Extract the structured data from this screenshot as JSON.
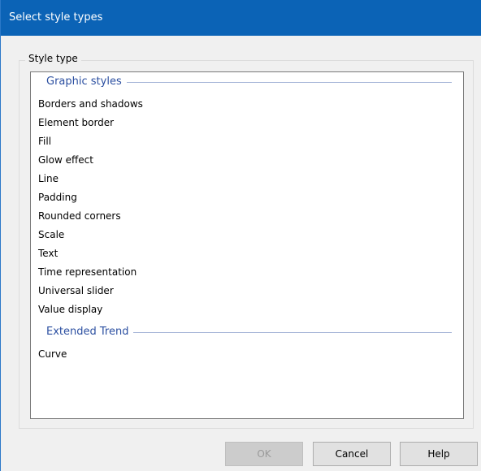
{
  "window": {
    "title": "Select style types"
  },
  "style_type_group": {
    "label": "Style type",
    "categories": [
      {
        "header": "Graphic styles",
        "items": [
          "Borders and shadows",
          "Element border",
          "Fill",
          "Glow effect",
          "Line",
          "Padding",
          "Rounded corners",
          "Scale",
          "Text",
          "Time representation",
          "Universal slider",
          "Value display"
        ]
      },
      {
        "header": "Extended Trend",
        "items": [
          "Curve"
        ]
      }
    ]
  },
  "buttons": {
    "ok": {
      "label": "OK",
      "enabled": false
    },
    "cancel": {
      "label": "Cancel",
      "enabled": true
    },
    "help": {
      "label": "Help",
      "enabled": true
    }
  },
  "colors": {
    "titlebar": "#0b63b6",
    "group_header_text": "#2a4ea0",
    "dialog_bg": "#f0f0f0"
  }
}
